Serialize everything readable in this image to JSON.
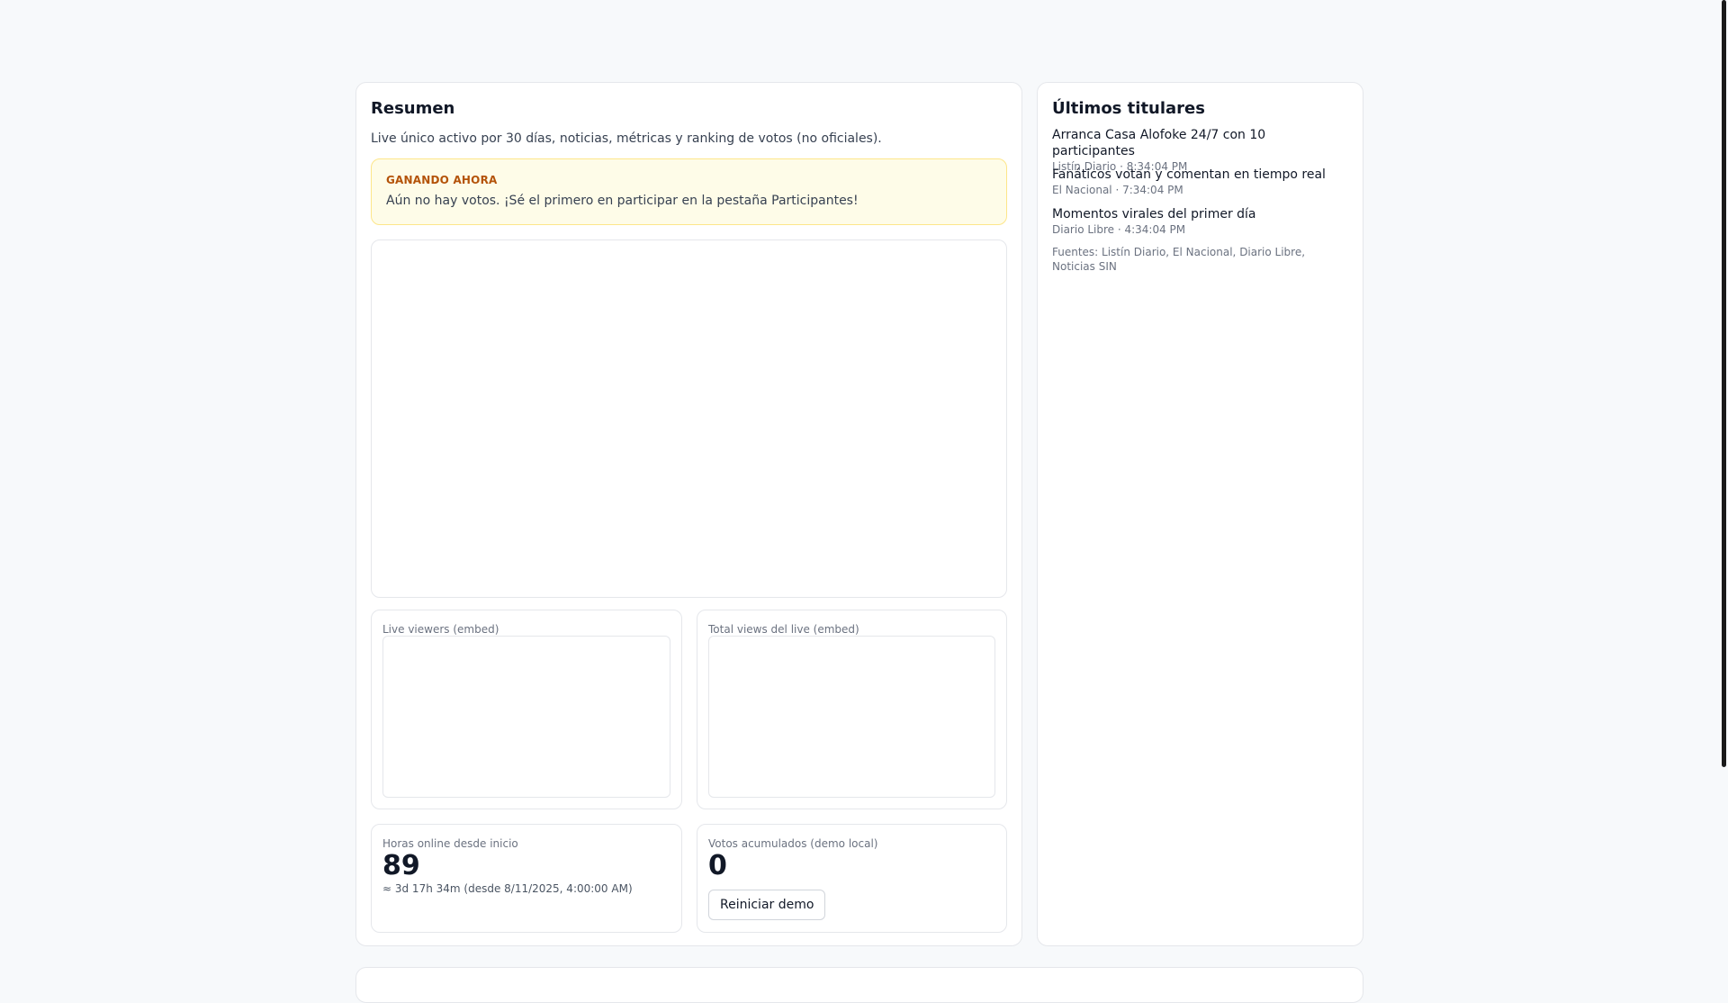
{
  "summary": {
    "title": "Resumen",
    "subtitle": "Live único activo por 30 días, noticias, métricas y ranking de votos (no oficiales).",
    "winner_label": "GANANDO AHORA",
    "winner_text": "Aún no hay votos. ¡Sé el primero en participar en la pestaña Participantes!"
  },
  "metrics": {
    "live_viewers_label": "Live viewers (embed)",
    "total_views_label": "Total views del live (embed)",
    "hours_label": "Horas online desde inicio",
    "hours_value": "89",
    "hours_note": "≈ 3d 17h 34m (desde 8/11/2025, 4:00:00 AM)",
    "votes_label": "Votos acumulados (demo local)",
    "votes_value": "0",
    "reset_button": "Reiniciar demo"
  },
  "headlines": {
    "title": "Últimos titulares",
    "items": [
      {
        "title": "Arranca Casa Alofoke 24/7 con 10 participantes",
        "meta": "Listín Diario · 8:34:04 PM"
      },
      {
        "title": "Fanáticos votan y comentan en tiempo real",
        "meta": "El Nacional · 7:34:04 PM"
      },
      {
        "title": "Momentos virales del primer día",
        "meta": "Diario Libre · 4:34:04 PM"
      }
    ],
    "sources": "Fuentes: Listín Diario, El Nacional, Diario Libre, Noticias SIN"
  }
}
